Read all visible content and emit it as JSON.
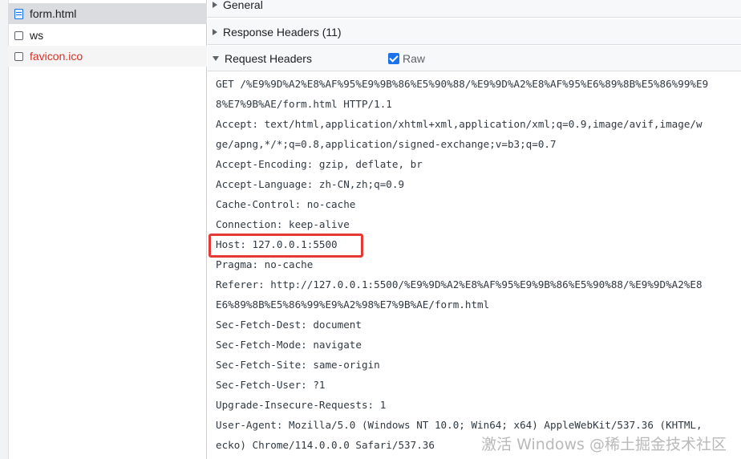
{
  "files": [
    {
      "name": "form.html",
      "icon": "document-icon",
      "state": "selected"
    },
    {
      "name": "ws",
      "icon": "checkbox-icon",
      "state": "normal"
    },
    {
      "name": "favicon.ico",
      "icon": "checkbox-icon",
      "state": "error"
    }
  ],
  "sections": {
    "general": {
      "label": "General",
      "expanded": false
    },
    "response_headers": {
      "label": "Response Headers (11)",
      "expanded": false
    },
    "request_headers": {
      "label": "Request Headers",
      "expanded": true,
      "raw_label": "Raw",
      "raw_checked": true
    }
  },
  "request_lines": [
    "GET /%E9%9D%A2%E8%AF%95%E9%9B%86%E5%90%88/%E9%9D%A2%E8%AF%95%E6%89%8B%E5%86%99%E9",
    "8%E7%9B%AE/form.html HTTP/1.1",
    "Accept: text/html,application/xhtml+xml,application/xml;q=0.9,image/avif,image/w",
    "ge/apng,*/*;q=0.8,application/signed-exchange;v=b3;q=0.7",
    "Accept-Encoding: gzip, deflate, br",
    "Accept-Language: zh-CN,zh;q=0.9",
    "Cache-Control: no-cache",
    "Connection: keep-alive",
    "Host: 127.0.0.1:5500",
    "Pragma: no-cache",
    "Referer: http://127.0.0.1:5500/%E9%9D%A2%E8%AF%95%E9%9B%86%E5%90%88/%E9%9D%A2%E8",
    "E6%89%8B%E5%86%99%E9%A2%98%E7%9B%AE/form.html",
    "Sec-Fetch-Dest: document",
    "Sec-Fetch-Mode: navigate",
    "Sec-Fetch-Site: same-origin",
    "Sec-Fetch-User: ?1",
    "Upgrade-Insecure-Requests: 1",
    "User-Agent: Mozilla/5.0 (Windows NT 10.0; Win64; x64) AppleWebKit/537.36 (KHTML,",
    "ecko) Chrome/114.0.0.0 Safari/537.36"
  ],
  "highlighted_line": "Host: 127.0.0.1:5500",
  "watermark": "激活 Windows @稀土掘金技术社区",
  "colors": {
    "accent": "#1a73e8",
    "error_text": "#d93025",
    "highlight": "#e53935",
    "section_bg": "#f6f8fa"
  }
}
